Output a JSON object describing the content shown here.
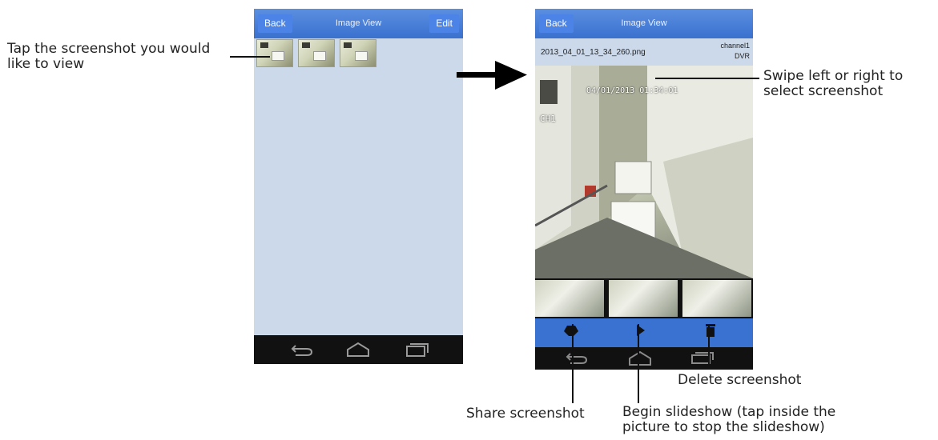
{
  "left_phone": {
    "back": "Back",
    "title": "Image View",
    "edit": "Edit"
  },
  "right_phone": {
    "back": "Back",
    "title": "Image View",
    "filename": "2013_04_01_13_34_260.png",
    "channel": "channel1",
    "source": "DVR",
    "camera_timestamp": "04/01/2013 01:34:01",
    "camera_label": "CH1"
  },
  "callouts": {
    "tap": "Tap the screenshot you would like to view",
    "swipe": "Swipe left or right to select screenshot",
    "delete": "Delete screenshot",
    "share": "Share screenshot",
    "slideshow": "Begin slideshow (tap inside the picture to stop the slideshow)"
  }
}
